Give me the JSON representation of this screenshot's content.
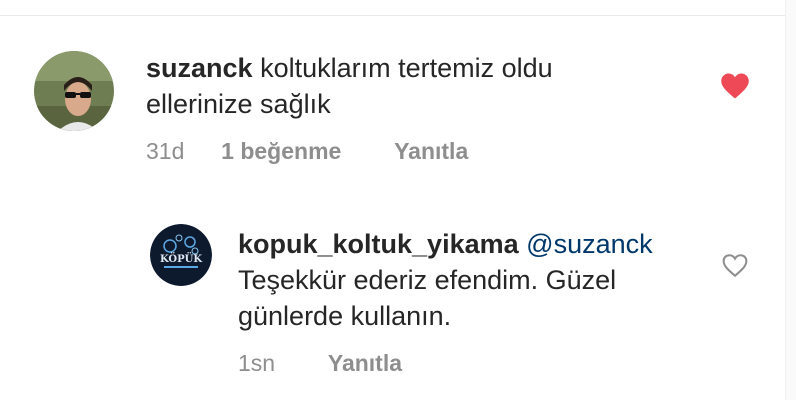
{
  "comment": {
    "username": "suzanck",
    "text": "koltuklarım tertemiz oldu ellerinize sağlık",
    "time": "31d",
    "likes": "1 beğenme",
    "reply_label": "Yanıtla",
    "liked": true,
    "like_color": "#ed4956",
    "like_icon": "heart-filled-icon"
  },
  "reply": {
    "username": "kopuk_koltuk_yikama",
    "mention": "@suzanck",
    "text": "Teşekkür ederiz efendim. Güzel günlerde kullanın.",
    "time": "1sn",
    "reply_label": "Yanıtla",
    "like_icon": "heart-outline-icon",
    "avatar_logo": "KÖPÜK"
  },
  "colors": {
    "meta_gray": "#8e8e8e",
    "mention_blue": "#00376b",
    "logo_bg": "#0d1a2e"
  }
}
